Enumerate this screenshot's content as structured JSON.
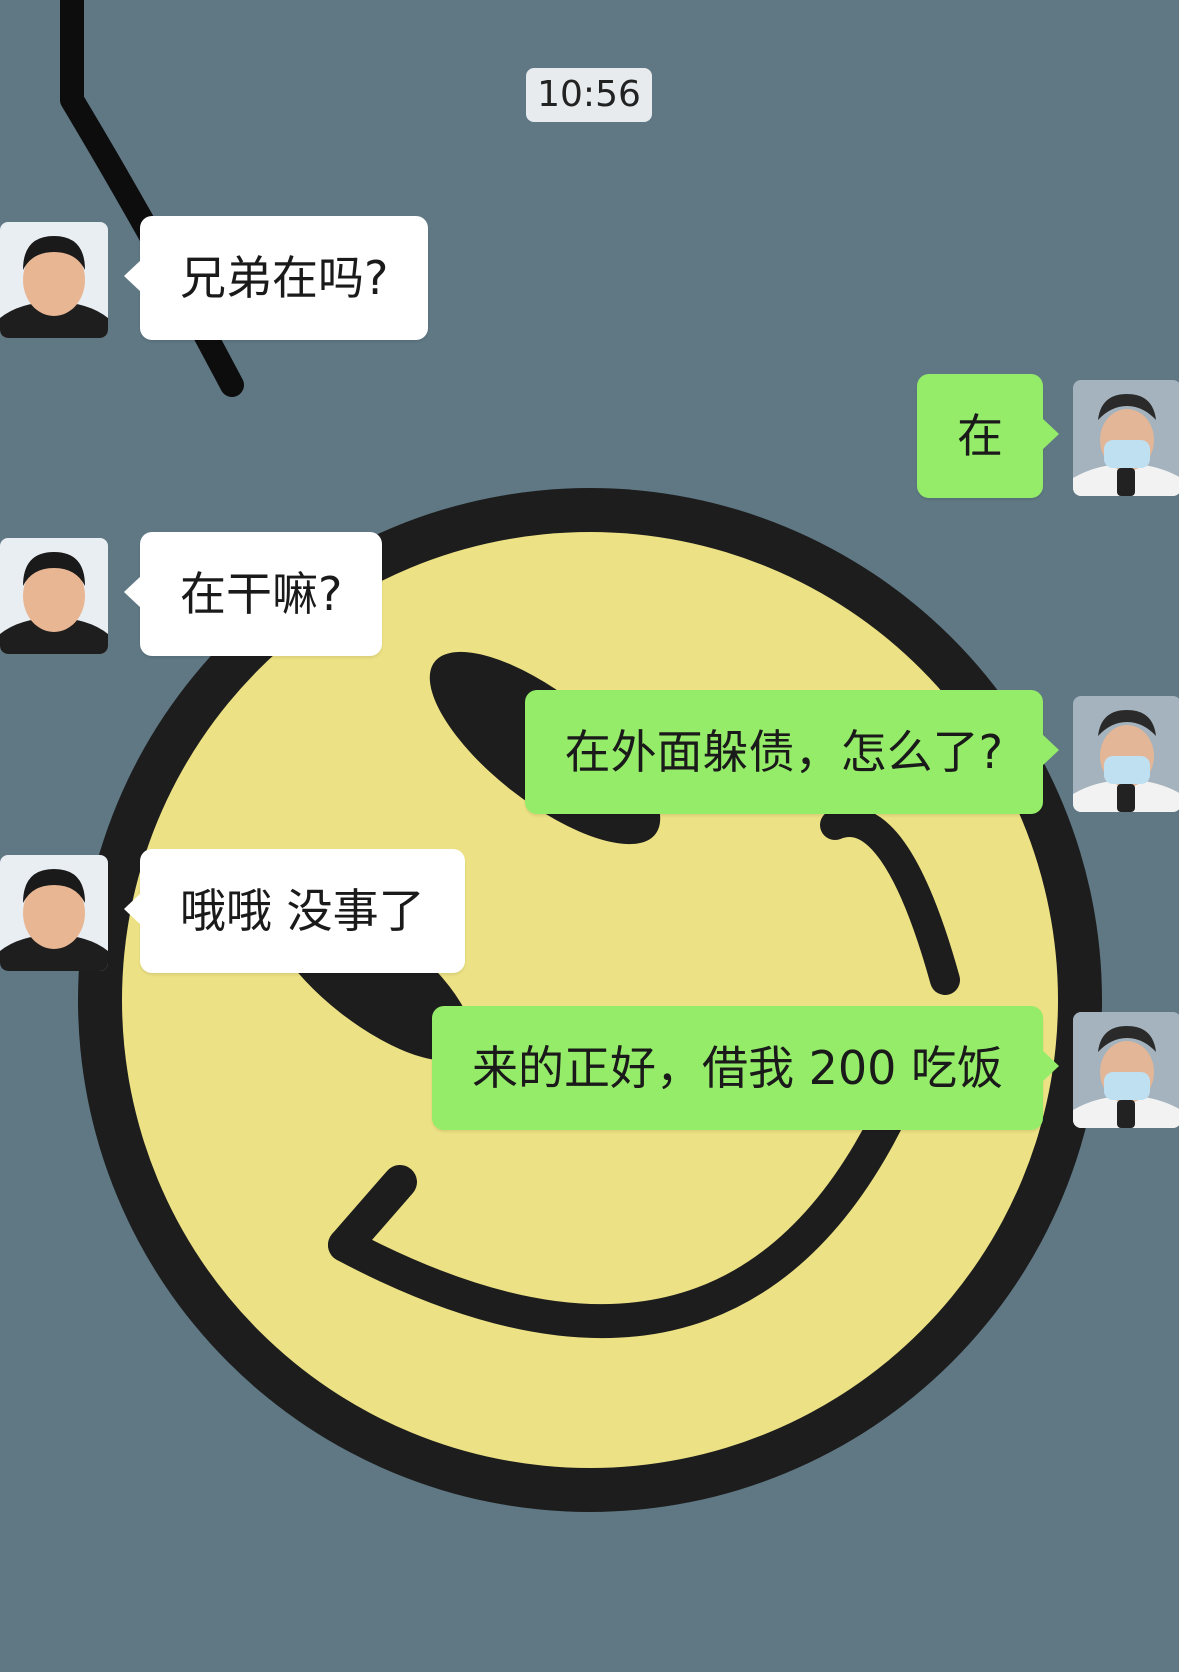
{
  "time_label": "10:56",
  "contact_avatar": "contact-avatar",
  "self_avatar": "self-avatar",
  "messages": [
    {
      "side": "in",
      "text": "兄弟在吗?"
    },
    {
      "side": "out",
      "text": "在"
    },
    {
      "side": "in",
      "text": "在干嘛?"
    },
    {
      "side": "out",
      "text": "在外面躲债，怎么了?"
    },
    {
      "side": "in",
      "text": "哦哦 没事了"
    },
    {
      "side": "out",
      "text": "来的正好，借我 200 吃饭"
    }
  ],
  "colors": {
    "background": "#5f7884",
    "incoming_bubble": "#ffffff",
    "outgoing_bubble": "#95ec69",
    "smiley_face": "#ece184",
    "smiley_outline": "#1d1d1d"
  }
}
